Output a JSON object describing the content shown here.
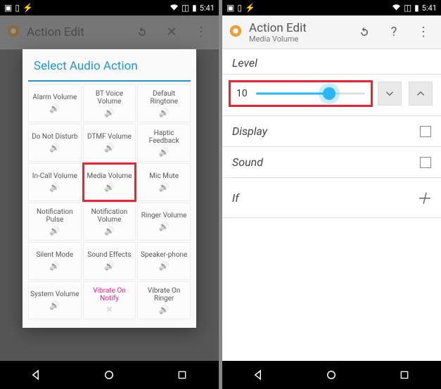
{
  "status": {
    "time": "5:41"
  },
  "left": {
    "appbar": {
      "title": "Action Edit"
    },
    "dialog": {
      "title": "Select Audio Action",
      "items": [
        {
          "label": "Alarm Volume"
        },
        {
          "label": "BT Voice Volume"
        },
        {
          "label": "Default Ringtone"
        },
        {
          "label": "Do Not Disturb"
        },
        {
          "label": "DTMF Volume"
        },
        {
          "label": "Haptic Feedback"
        },
        {
          "label": "In-Call Volume"
        },
        {
          "label": "Media Volume",
          "highlight": true
        },
        {
          "label": "Mic Mute"
        },
        {
          "label": "Notification Pulse"
        },
        {
          "label": "Notification Volume"
        },
        {
          "label": "Ringer Volume"
        },
        {
          "label": "Silent Mode"
        },
        {
          "label": "Sound Effects"
        },
        {
          "label": "Speaker-phone"
        },
        {
          "label": "System Volume"
        },
        {
          "label": "Vibrate On Notify",
          "special": true
        },
        {
          "label": "Vibrate On Ringer"
        }
      ]
    }
  },
  "right": {
    "appbar": {
      "title": "Action Edit",
      "subtitle": "Media Volume"
    },
    "level": {
      "label": "Level",
      "value": "10"
    },
    "rows": {
      "display": "Display",
      "sound": "Sound",
      "if": "If"
    }
  }
}
